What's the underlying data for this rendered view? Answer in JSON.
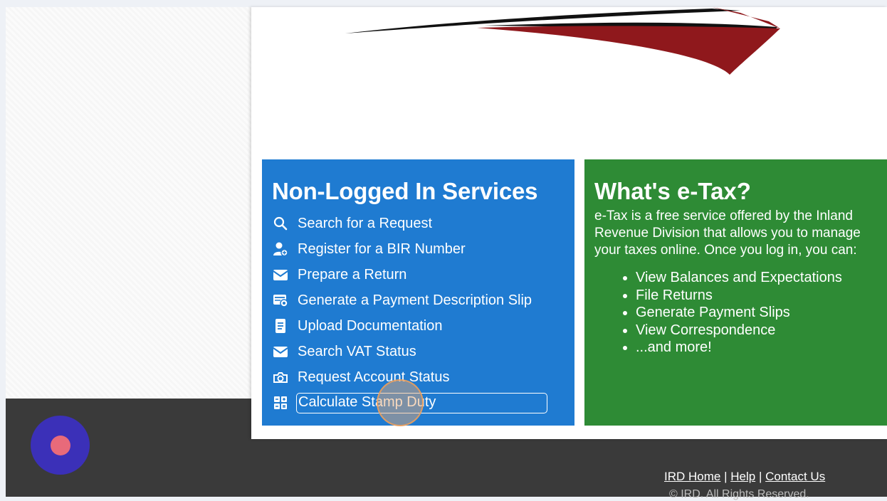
{
  "left_panel": {
    "title": "Non-Logged In Services",
    "items": [
      {
        "label": "Search for a Request",
        "icon": "search-icon"
      },
      {
        "label": "Register for a BIR Number",
        "icon": "user-add-icon"
      },
      {
        "label": "Prepare a Return",
        "icon": "envelope-open-icon"
      },
      {
        "label": "Generate a Payment Description Slip",
        "icon": "payment-slip-icon"
      },
      {
        "label": "Upload Documentation",
        "icon": "document-icon"
      },
      {
        "label": "Search VAT Status",
        "icon": "envelope-icon"
      },
      {
        "label": "Request Account Status",
        "icon": "camera-icon"
      },
      {
        "label": "Calculate Stamp Duty",
        "icon": "grid-calculator-icon"
      }
    ]
  },
  "right_panel": {
    "title": "What's e-Tax?",
    "description": "e-Tax is a free service offered by the Inland Revenue Division that allows you to manage your taxes online. Once you log in, you can:",
    "features": [
      "View Balances and Expectations",
      "File Returns",
      "Generate Payment Slips",
      "View Correspondence",
      "...and more!"
    ]
  },
  "footer": {
    "links": [
      "IRD Home",
      "Help",
      "Contact Us"
    ],
    "separator": "|",
    "copyright": "© IRD. All Rights Reserved."
  },
  "colors": {
    "blue_panel": "#1f7bd1",
    "green_panel": "#2e8b35",
    "footer": "#3a3a3a",
    "record_button": "#3b30b8"
  }
}
